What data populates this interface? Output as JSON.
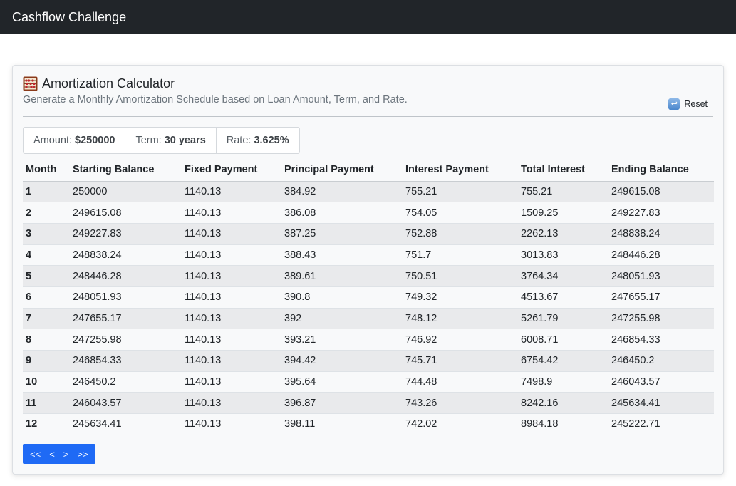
{
  "navbar": {
    "brand": "Cashflow Challenge"
  },
  "card": {
    "title": "Amortization Calculator",
    "subtitle": "Generate a Monthly Amortization Schedule based on Loan Amount, Term, and Rate.",
    "reset_label": "Reset",
    "title_icon": "abacus-icon",
    "reset_icon": "undo-arrow-icon"
  },
  "summary": {
    "amount_label": "Amount:",
    "amount_value": "$250000",
    "term_label": "Term:",
    "term_value": "30 years",
    "rate_label": "Rate:",
    "rate_value": "3.625%"
  },
  "table": {
    "headers": [
      "Month",
      "Starting Balance",
      "Fixed Payment",
      "Principal Payment",
      "Interest Payment",
      "Total Interest",
      "Ending Balance"
    ],
    "rows": [
      [
        "1",
        "250000",
        "1140.13",
        "384.92",
        "755.21",
        "755.21",
        "249615.08"
      ],
      [
        "2",
        "249615.08",
        "1140.13",
        "386.08",
        "754.05",
        "1509.25",
        "249227.83"
      ],
      [
        "3",
        "249227.83",
        "1140.13",
        "387.25",
        "752.88",
        "2262.13",
        "248838.24"
      ],
      [
        "4",
        "248838.24",
        "1140.13",
        "388.43",
        "751.7",
        "3013.83",
        "248446.28"
      ],
      [
        "5",
        "248446.28",
        "1140.13",
        "389.61",
        "750.51",
        "3764.34",
        "248051.93"
      ],
      [
        "6",
        "248051.93",
        "1140.13",
        "390.8",
        "749.32",
        "4513.67",
        "247655.17"
      ],
      [
        "7",
        "247655.17",
        "1140.13",
        "392",
        "748.12",
        "5261.79",
        "247255.98"
      ],
      [
        "8",
        "247255.98",
        "1140.13",
        "393.21",
        "746.92",
        "6008.71",
        "246854.33"
      ],
      [
        "9",
        "246854.33",
        "1140.13",
        "394.42",
        "745.71",
        "6754.42",
        "246450.2"
      ],
      [
        "10",
        "246450.2",
        "1140.13",
        "395.64",
        "744.48",
        "7498.9",
        "246043.57"
      ],
      [
        "11",
        "246043.57",
        "1140.13",
        "396.87",
        "743.26",
        "8242.16",
        "245634.41"
      ],
      [
        "12",
        "245634.41",
        "1140.13",
        "398.11",
        "742.02",
        "8984.18",
        "245222.71"
      ]
    ]
  },
  "pager": {
    "first": "<<",
    "prev": "<",
    "next": ">",
    "last": ">>"
  },
  "colors": {
    "navbar": "#212529",
    "pager": "#1f6af5"
  }
}
